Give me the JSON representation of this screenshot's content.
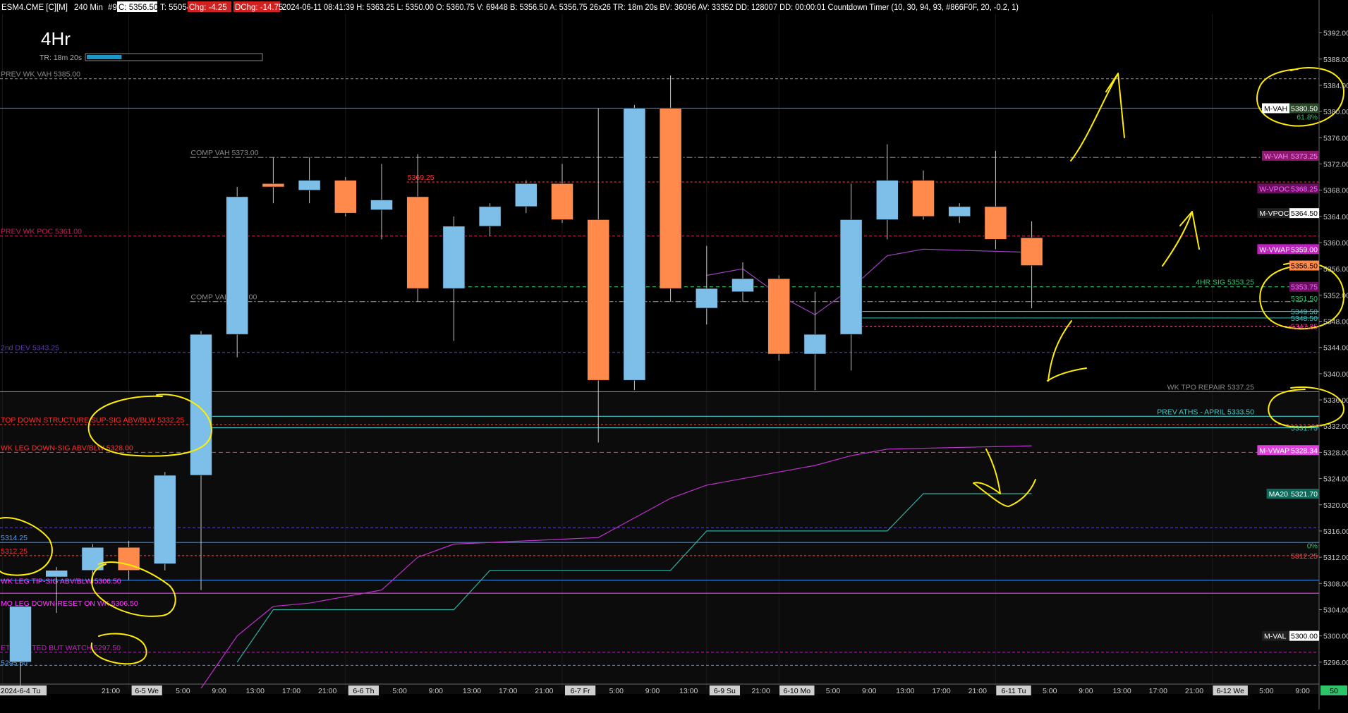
{
  "header": {
    "symbol": "ESM4.CME [C][M]",
    "interval": "240 Min",
    "bar_no": "#9",
    "close": "C: 5356.50",
    "t": "T: 55054",
    "chg": "Chg: -4.25",
    "dchg": "DChg: -14.75",
    "info": "2024-06-11 08:41:39 H: 5363.25 L: 5350.00 O: 5360.75 V: 69448 B: 5356.50 A: 5356.75 26x26 TR: 18m 20s BV: 36096 AV: 33352 DD: 128007 DD: 00:00:01 Countdown Timer  (10, 30, 94, 93, #866F0F, 20, -0.2, 1)"
  },
  "timeframe": {
    "label": "4Hr",
    "timer": "TR: 18m 20s",
    "progress": 0.2
  },
  "colors": {
    "up": "#7dbfe9",
    "down": "#ff8a4c",
    "grid": "#2a2a2a",
    "annotation": "#ffee00",
    "magenta": "#e040e0",
    "teal": "#40c0b0"
  },
  "chart_data": {
    "type": "candlestick",
    "ylim": [
      5292,
      5394
    ],
    "y_ticks": [
      5392.0,
      5388.0,
      5384.0,
      5380.0,
      5376.0,
      5372.0,
      5368.0,
      5364.0,
      5360.0,
      5356.0,
      5352.0,
      5348.0,
      5344.0,
      5340.0,
      5336.0,
      5332.0,
      5328.0,
      5324.0,
      5320.0,
      5316.0,
      5312.0,
      5308.0,
      5304.0,
      5300.0,
      5296.0
    ],
    "x_ticks": [
      {
        "slot": 0,
        "label": "2024-6-4 Tu",
        "session": true
      },
      {
        "slot": 2.5,
        "label": "21:00",
        "session": false
      },
      {
        "slot": 3.5,
        "label": "6-5 We",
        "session": true
      },
      {
        "slot": 4.5,
        "label": "5:00",
        "session": false
      },
      {
        "slot": 5.5,
        "label": "9:00",
        "session": false
      },
      {
        "slot": 6.5,
        "label": "13:00",
        "session": false
      },
      {
        "slot": 7.5,
        "label": "17:00",
        "session": false
      },
      {
        "slot": 8.5,
        "label": "21:00",
        "session": false
      },
      {
        "slot": 9.5,
        "label": "6-6 Th",
        "session": true
      },
      {
        "slot": 10.5,
        "label": "5:00",
        "session": false
      },
      {
        "slot": 11.5,
        "label": "9:00",
        "session": false
      },
      {
        "slot": 12.5,
        "label": "13:00",
        "session": false
      },
      {
        "slot": 13.5,
        "label": "17:00",
        "session": false
      },
      {
        "slot": 14.5,
        "label": "21:00",
        "session": false
      },
      {
        "slot": 15.5,
        "label": "6-7 Fr",
        "session": true
      },
      {
        "slot": 16.5,
        "label": "5:00",
        "session": false
      },
      {
        "slot": 17.5,
        "label": "9:00",
        "session": false
      },
      {
        "slot": 18.5,
        "label": "13:00",
        "session": false
      },
      {
        "slot": 19.5,
        "label": "6-9 Su",
        "session": true
      },
      {
        "slot": 20.5,
        "label": "21:00",
        "session": false
      },
      {
        "slot": 21.5,
        "label": "6-10 Mo",
        "session": true
      },
      {
        "slot": 22.5,
        "label": "5:00",
        "session": false
      },
      {
        "slot": 23.5,
        "label": "9:00",
        "session": false
      },
      {
        "slot": 24.5,
        "label": "13:00",
        "session": false
      },
      {
        "slot": 25.5,
        "label": "17:00",
        "session": false
      },
      {
        "slot": 26.5,
        "label": "21:00",
        "session": false
      },
      {
        "slot": 27.5,
        "label": "6-11 Tu",
        "session": true
      },
      {
        "slot": 28.5,
        "label": "5:00",
        "session": false
      },
      {
        "slot": 29.5,
        "label": "9:00",
        "session": false
      },
      {
        "slot": 30.5,
        "label": "13:00",
        "session": false
      },
      {
        "slot": 31.5,
        "label": "17:00",
        "session": false
      },
      {
        "slot": 32.5,
        "label": "21:00",
        "session": false
      },
      {
        "slot": 33.5,
        "label": "6-12 We",
        "session": true
      },
      {
        "slot": 34.5,
        "label": "5:00",
        "session": false
      },
      {
        "slot": 35.5,
        "label": "9:00",
        "session": false
      }
    ],
    "candles": [
      {
        "slot": 0,
        "o": 5296,
        "h": 5304.5,
        "l": 5292,
        "c": 5304.5
      },
      {
        "slot": 1,
        "o": 5309,
        "h": 5310.5,
        "l": 5303.5,
        "c": 5310
      },
      {
        "slot": 2,
        "o": 5310,
        "h": 5314,
        "l": 5308,
        "c": 5313.5
      },
      {
        "slot": 3,
        "o": 5313.5,
        "h": 5314.5,
        "l": 5308.5,
        "c": 5310
      },
      {
        "slot": 4,
        "o": 5311,
        "h": 5325,
        "l": 5310,
        "c": 5324.5
      },
      {
        "slot": 5,
        "o": 5324.5,
        "h": 5346.5,
        "l": 5307,
        "c": 5346
      },
      {
        "slot": 6,
        "o": 5346,
        "h": 5368.5,
        "l": 5342.5,
        "c": 5367
      },
      {
        "slot": 7,
        "o": 5369,
        "h": 5373,
        "l": 5366,
        "c": 5368.5
      },
      {
        "slot": 8,
        "o": 5368,
        "h": 5373,
        "l": 5366,
        "c": 5369.5
      },
      {
        "slot": 9,
        "o": 5369.5,
        "h": 5370,
        "l": 5364,
        "c": 5364.5
      },
      {
        "slot": 10,
        "o": 5365,
        "h": 5372,
        "l": 5360.5,
        "c": 5366.5
      },
      {
        "slot": 11,
        "o": 5367,
        "h": 5373.5,
        "l": 5351,
        "c": 5353
      },
      {
        "slot": 12,
        "o": 5353,
        "h": 5364,
        "l": 5345,
        "c": 5362.5
      },
      {
        "slot": 13,
        "o": 5362.5,
        "h": 5366,
        "l": 5361,
        "c": 5365.5
      },
      {
        "slot": 14,
        "o": 5365.5,
        "h": 5369.5,
        "l": 5364.5,
        "c": 5369
      },
      {
        "slot": 15,
        "o": 5369,
        "h": 5372,
        "l": 5363,
        "c": 5363.5
      },
      {
        "slot": 16,
        "o": 5363.5,
        "h": 5380.5,
        "l": 5329.5,
        "c": 5339
      },
      {
        "slot": 17,
        "o": 5339,
        "h": 5381,
        "l": 5337.5,
        "c": 5380.5
      },
      {
        "slot": 18,
        "o": 5380.5,
        "h": 5385.5,
        "l": 5351,
        "c": 5353
      },
      {
        "slot": 19,
        "o": 5350,
        "h": 5359.5,
        "l": 5347.5,
        "c": 5353
      },
      {
        "slot": 20,
        "o": 5352.5,
        "h": 5357,
        "l": 5351,
        "c": 5354.5
      },
      {
        "slot": 21,
        "o": 5354.5,
        "h": 5355,
        "l": 5342,
        "c": 5343
      },
      {
        "slot": 22,
        "o": 5343,
        "h": 5352.5,
        "l": 5337.5,
        "c": 5346
      },
      {
        "slot": 23,
        "o": 5346,
        "h": 5369,
        "l": 5340.5,
        "c": 5363.5
      },
      {
        "slot": 24,
        "o": 5363.5,
        "h": 5375,
        "l": 5360.5,
        "c": 5369.5
      },
      {
        "slot": 25,
        "o": 5369.5,
        "h": 5371,
        "l": 5363.5,
        "c": 5364
      },
      {
        "slot": 26,
        "o": 5364,
        "h": 5366,
        "l": 5363,
        "c": 5365.5
      },
      {
        "slot": 27,
        "o": 5365.5,
        "h": 5374,
        "l": 5359,
        "c": 5360.5
      },
      {
        "slot": 28,
        "o": 5360.75,
        "h": 5363.25,
        "l": 5350.0,
        "c": 5356.5
      }
    ],
    "levels": [
      {
        "price": 5385.0,
        "text": "PREV WK VAH  5385.00",
        "color": "#8a8a8a",
        "dash": "4,3",
        "side": "left"
      },
      {
        "price": 5380.5,
        "text": "",
        "color": "#2f78c8",
        "dash": "",
        "side": "left"
      },
      {
        "price": 5373.0,
        "text": "COMP VAH  5373.00",
        "color": "#8a8a8a",
        "dash": "8,3,2,3",
        "side": "left",
        "from_slot": 5
      },
      {
        "price": 5369.25,
        "text": "5369.25",
        "color": "#ff3030",
        "dash": "3,3",
        "side": "left",
        "from_slot": 11,
        "text_color": "#ff3030"
      },
      {
        "price": 5361.0,
        "text": "PREV WK POC  5361.00",
        "color": "#c02060",
        "dash": "4,3",
        "side": "left"
      },
      {
        "price": 5353.25,
        "text": "4HR SIG  5353.25",
        "color": "#2ec46a",
        "dash": "5,4",
        "side": "right",
        "from_slot": 12
      },
      {
        "price": 5351.0,
        "text": "COMP VAL  5351.00",
        "color": "#8a8a8a",
        "dash": "8,3,2,3",
        "side": "left",
        "from_slot": 5
      },
      {
        "price": 5349.5,
        "text": "",
        "color": "#40c0c0",
        "dash": "",
        "side": "left",
        "from_slot": 23
      },
      {
        "price": 5348.5,
        "text": "",
        "color": "#40c0c0",
        "dash": "",
        "side": "left",
        "from_slot": 23
      },
      {
        "price": 5347.25,
        "text": "",
        "color": "#ff40a0",
        "dash": "3,3",
        "side": "left",
        "from_slot": 23
      },
      {
        "price": 5343.25,
        "text": "2nd DEV  5343.25",
        "color": "#5a3ab0",
        "dash": "4,3",
        "side": "left"
      },
      {
        "price": 5337.25,
        "text": "WK TPO REPAIR  5337.25",
        "color": "#888888",
        "dash": "",
        "side": "right"
      },
      {
        "price": 5333.5,
        "text": "PREV ATHS - APRIL  5333.50",
        "color": "#40c8c8",
        "dash": "",
        "side": "right",
        "from_slot": 5
      },
      {
        "price": 5332.25,
        "text": "TOP DOWN STRUCTURE SUP-SIG ABV/BLW  5332.25",
        "color": "#ff3030",
        "dash": "3,3",
        "side": "left"
      },
      {
        "price": 5331.75,
        "text": "",
        "color": "#40c8c8",
        "dash": "",
        "side": "left",
        "from_slot": 5
      },
      {
        "price": 5328.0,
        "text": "WK LEG DOWN-SIG ABV/BLW  5328.00",
        "color": "#ff3030",
        "dash": "6,4",
        "side": "left"
      },
      {
        "price": 5316.5,
        "text": "",
        "color": "#5a3ab0",
        "dash": "4,3",
        "side": "left"
      },
      {
        "price": 5314.25,
        "text": "5314.25",
        "color": "#3a8ae8",
        "dash": "",
        "side": "left",
        "text_color": "#4ea0ff"
      },
      {
        "price": 5312.25,
        "text": "5312.25",
        "color": "#ff3030",
        "dash": "3,3",
        "side": "left",
        "text_color": "#ff3030"
      },
      {
        "price": 5308.5,
        "text": "",
        "color": "#3a8ae8",
        "dash": "",
        "side": "left"
      },
      {
        "price": 5306.5,
        "text": "",
        "color": "#ff30ff",
        "dash": "",
        "side": "left"
      },
      {
        "price": 5297.5,
        "text": "ETH TESTED BUT WATCH  5297.50",
        "color": "#c020c0",
        "dash": "4,3",
        "side": "left"
      },
      {
        "price": 5295.5,
        "text": "",
        "color": "#3a8ae8",
        "dash": "4,3",
        "side": "left"
      }
    ],
    "extra_labels": [
      {
        "price": 5308.0,
        "text": "WK LEG TIP-SIG ABV/BLW  5306.50",
        "color": "#ff40ff"
      },
      {
        "price": 5304.6,
        "text": "MO LEG DOWN-RESET ON WK  5306.50",
        "color": "#ff40ff"
      },
      {
        "price": 5295.5,
        "text": "5295.50",
        "color": "#4ea0ff"
      }
    ],
    "vwap_line": [
      [
        5,
        5292
      ],
      [
        6,
        5300
      ],
      [
        7,
        5304.5
      ],
      [
        8,
        5305
      ],
      [
        9,
        5306
      ],
      [
        10,
        5307
      ],
      [
        11,
        5312
      ],
      [
        12,
        5314
      ],
      [
        14,
        5314.5
      ],
      [
        16,
        5315
      ],
      [
        17,
        5318
      ],
      [
        18,
        5321
      ],
      [
        19,
        5323
      ],
      [
        21,
        5325
      ],
      [
        22,
        5326
      ],
      [
        23,
        5327.5
      ],
      [
        24,
        5328.5
      ],
      [
        28,
        5329
      ]
    ],
    "ma20_line": [
      [
        6,
        5296
      ],
      [
        7,
        5304
      ],
      [
        9,
        5304
      ],
      [
        10,
        5304
      ],
      [
        12,
        5304
      ],
      [
        13,
        5310
      ],
      [
        14,
        5310
      ],
      [
        17,
        5310
      ],
      [
        18,
        5310
      ],
      [
        19,
        5316
      ],
      [
        20,
        5316
      ],
      [
        24,
        5316
      ],
      [
        25,
        5321.7
      ],
      [
        28,
        5321.7
      ]
    ],
    "wvwap_line": [
      [
        19,
        5355
      ],
      [
        20,
        5356
      ],
      [
        21,
        5352
      ],
      [
        22,
        5349
      ],
      [
        23,
        5353
      ],
      [
        24,
        5358
      ],
      [
        25,
        5359
      ],
      [
        28,
        5358.5
      ]
    ],
    "right_tags": [
      {
        "price": 5380.5,
        "text": "M-VAH",
        "value": "5380.50",
        "bg": "#ffffff",
        "fg": "#000000",
        "vfg": "#ffffff",
        "vbg": "#2a4a2a"
      },
      {
        "price": 5379.2,
        "text": "",
        "value": "61.8%",
        "bg": "",
        "fg": "#2ec46a",
        "vfg": "#2ec46a",
        "vbg": ""
      },
      {
        "price": 5373.25,
        "text": "W-VAH",
        "value": "5373.25",
        "bg": "#8b1a6b",
        "fg": "#ff80ff",
        "vfg": "#ff80ff",
        "vbg": "#8b1a6b"
      },
      {
        "price": 5368.25,
        "text": "W-VPOC",
        "value": "5368.25",
        "bg": "#6a1060",
        "fg": "#ff60ff",
        "vfg": "#ff60ff",
        "vbg": "#6a1060"
      },
      {
        "price": 5364.5,
        "text": "M-VPOC",
        "value": "5364.50",
        "bg": "#202020",
        "fg": "#ffffff",
        "vfg": "#000000",
        "vbg": "#ffffff"
      },
      {
        "price": 5359.0,
        "text": "W-VWAP",
        "value": "5359.00",
        "bg": "#c020c0",
        "fg": "#ffffff",
        "vfg": "#ffffff",
        "vbg": "#c020c0"
      },
      {
        "price": 5356.5,
        "text": "",
        "value": "5356.50",
        "bg": "",
        "fg": "",
        "vfg": "#000000",
        "vbg": "#ff8a4c"
      },
      {
        "price": 5353.25,
        "text": "",
        "value": "5353.75",
        "bg": "",
        "fg": "",
        "vfg": "#ff60ff",
        "vbg": "#6a1060"
      },
      {
        "price": 5351.5,
        "text": "",
        "value": "5351.50",
        "bg": "",
        "fg": "",
        "vfg": "#2ec46a",
        "vbg": ""
      },
      {
        "price": 5349.5,
        "text": "",
        "value": "5349.50",
        "bg": "",
        "fg": "",
        "vfg": "#40c0c0",
        "vbg": ""
      },
      {
        "price": 5348.5,
        "text": "",
        "value": "5348.50",
        "bg": "",
        "fg": "",
        "vfg": "#40c0c0",
        "vbg": ""
      },
      {
        "price": 5347.25,
        "text": "",
        "value": "5347.25",
        "bg": "",
        "fg": "",
        "vfg": "#ff40a0",
        "vbg": ""
      },
      {
        "price": 5331.75,
        "text": "",
        "value": "5331.75",
        "bg": "",
        "fg": "",
        "vfg": "#40c8c8",
        "vbg": ""
      },
      {
        "price": 5328.34,
        "text": "M-VWAP",
        "value": "5328.34",
        "bg": "#e040e0",
        "fg": "#ffffff",
        "vfg": "#ffffff",
        "vbg": "#e040e0"
      },
      {
        "price": 5321.7,
        "text": "MA20",
        "value": "5321.70",
        "bg": "#0f6a5a",
        "fg": "#ffffff",
        "vfg": "#ffffff",
        "vbg": "#0f6a5a"
      },
      {
        "price": 5313.8,
        "text": "",
        "value": "0%",
        "bg": "",
        "fg": "",
        "vfg": "#2ec46a",
        "vbg": ""
      },
      {
        "price": 5312.25,
        "text": "",
        "value": "5312.25",
        "bg": "",
        "fg": "",
        "vfg": "#ff5050",
        "vbg": ""
      },
      {
        "price": 5300.0,
        "text": "M-VAL",
        "value": "5300.00",
        "bg": "#202020",
        "fg": "#ffffff",
        "vfg": "#000000",
        "vbg": "#ffffff"
      }
    ],
    "last_price_marker": "50"
  }
}
